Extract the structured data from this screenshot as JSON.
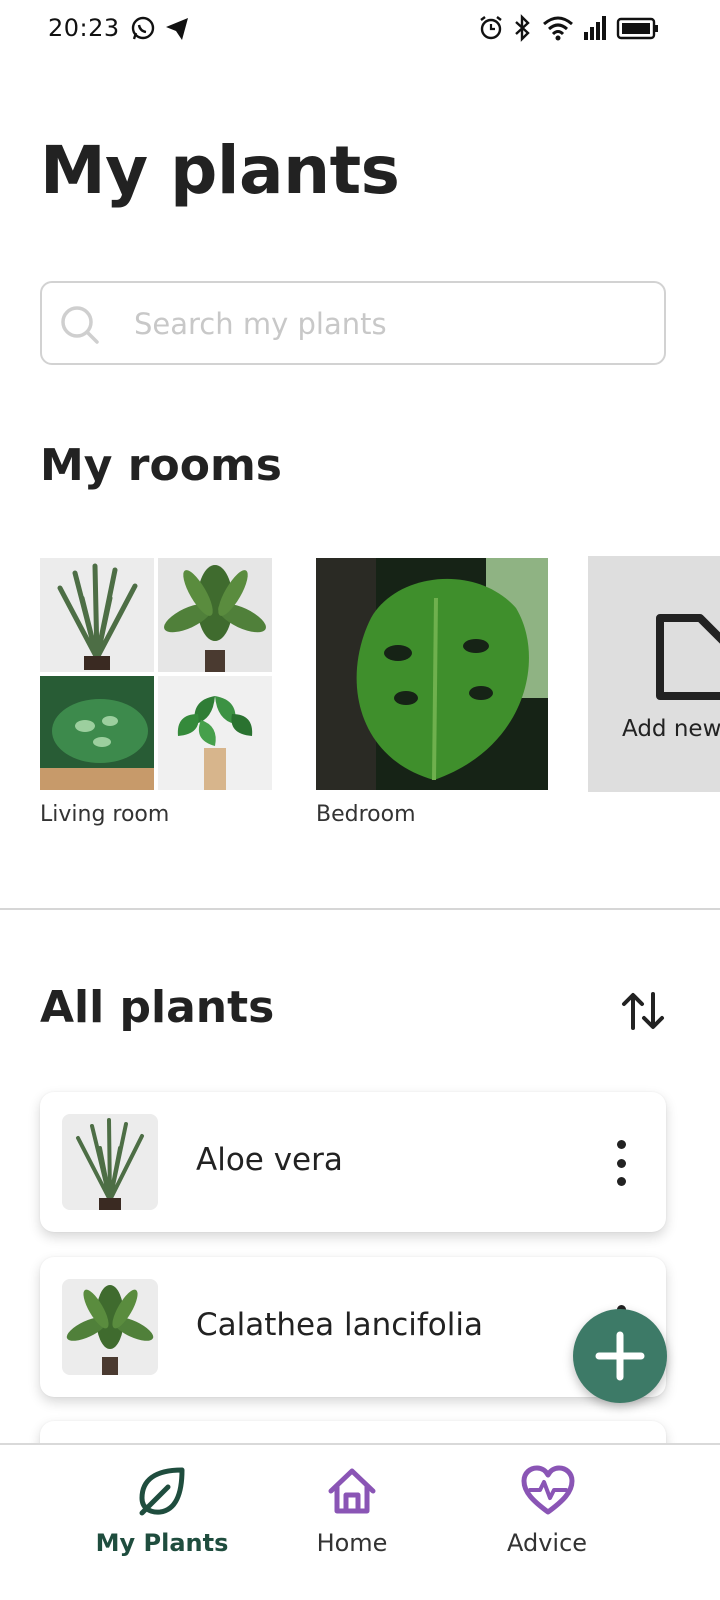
{
  "status_bar": {
    "time": "20:23"
  },
  "header": {
    "title": "My plants"
  },
  "search": {
    "placeholder": "Search my plants"
  },
  "rooms": {
    "title": "My rooms",
    "items": [
      {
        "label": "Living room"
      },
      {
        "label": "Bedroom"
      }
    ],
    "add_label": "Add new"
  },
  "plants": {
    "title": "All plants",
    "items": [
      {
        "name": "Aloe vera"
      },
      {
        "name": "Calathea lancifolia"
      }
    ]
  },
  "nav": {
    "items": [
      {
        "label": "My Plants",
        "icon": "leaf-icon",
        "active": true
      },
      {
        "label": "Home",
        "icon": "home-icon",
        "active": false
      },
      {
        "label": "Advice",
        "icon": "heart-pulse-icon",
        "active": false
      }
    ]
  },
  "colors": {
    "accent": "#3d7a67",
    "nav_active": "#1f4d3e",
    "nav_inactive_icon": "#8a55b5"
  }
}
